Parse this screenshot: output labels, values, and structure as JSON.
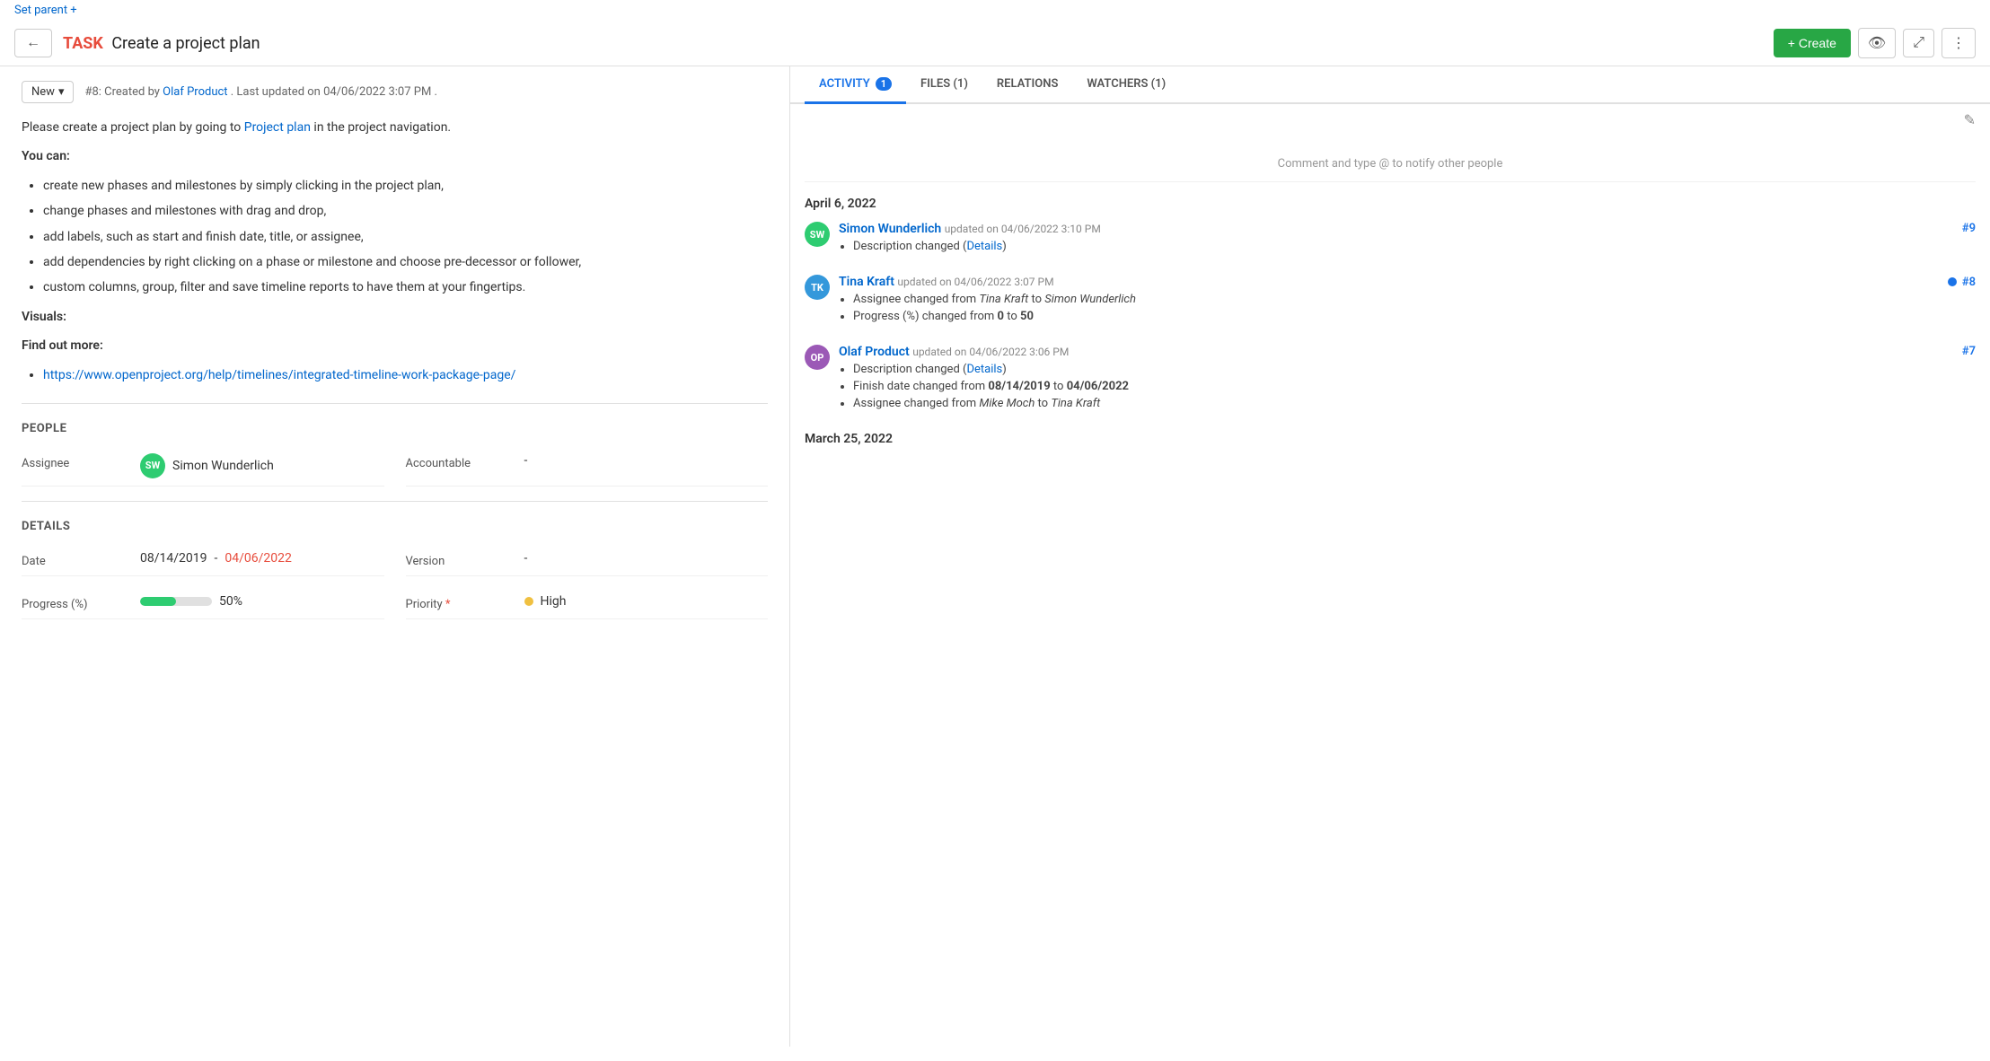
{
  "header": {
    "back_label": "←",
    "task_label": "TASK",
    "title": "Create a project plan",
    "create_label": "+ Create",
    "create_arrow": "▾",
    "watch_icon": "👁",
    "expand_icon": "⤢",
    "more_icon": "⋮"
  },
  "set_parent": {
    "label": "Set parent +",
    "href": "#"
  },
  "status": {
    "badge_label": "New",
    "badge_arrow": "▾",
    "meta": "#8: Created by ",
    "author": "Olaf Product",
    "meta_after": " . Last updated on 04/06/2022 3:07 PM ."
  },
  "description": {
    "intro": "Please create a project plan by going to ",
    "link_text": "Project plan",
    "intro_after": " in the project navigation.",
    "you_can": "You can:",
    "bullets": [
      "create new phases and milestones by simply clicking in the project plan,",
      "change phases and milestones with drag and drop,",
      "add labels, such as start and finish date, title, or assignee,",
      "add dependencies by right clicking on a phase or milestone and choose pre-decessor or follower,",
      "custom columns, group, filter and save timeline reports to have them at your fingertips."
    ],
    "visuals": "Visuals:",
    "find_out": "Find out more:",
    "link_url": "https://www.openproject.org/help/timelines/integrated-timeline-work-package-page/"
  },
  "people_section": {
    "title": "PEOPLE",
    "assignee_label": "Assignee",
    "assignee_name": "Simon Wunderlich",
    "assignee_initials": "SW",
    "accountable_label": "Accountable",
    "accountable_value": "-"
  },
  "details_section": {
    "title": "DETAILS",
    "date_label": "Date",
    "date_start": "08/14/2019",
    "date_dash": " - ",
    "date_end": "04/06/2022",
    "version_label": "Version",
    "version_value": "-",
    "progress_label": "Progress (%)",
    "progress_value": 50,
    "progress_display": "50%",
    "priority_label": "Priority",
    "priority_value": "High",
    "priority_required": "*"
  },
  "tabs": [
    {
      "id": "activity",
      "label": "ACTIVITY",
      "badge": "1",
      "active": true
    },
    {
      "id": "files",
      "label": "FILES (1)",
      "badge": null,
      "active": false
    },
    {
      "id": "relations",
      "label": "RELATIONS",
      "badge": null,
      "active": false
    },
    {
      "id": "watchers",
      "label": "WATCHERS (1)",
      "badge": null,
      "active": false
    }
  ],
  "activity": {
    "comment_hint": "Comment and type @ to notify other people",
    "date_group_1": "April 6, 2022",
    "items": [
      {
        "id": "9",
        "user": "Simon Wunderlich",
        "initials": "SW",
        "avatar_class": "avatar-sw",
        "meta": "updated on 04/06/2022 3:10 PM",
        "changes": [
          {
            "text": "Description changed (",
            "link": "Details",
            "text_after": ")"
          }
        ],
        "has_dot": false
      },
      {
        "id": "8",
        "user": "Tina Kraft",
        "initials": "TK",
        "avatar_class": "avatar-tk",
        "meta": "updated on 04/06/2022 3:07 PM",
        "changes": [
          {
            "text": "Assignee changed from Tina Kraft to Simon Wunderlich"
          },
          {
            "text": "Progress (%) changed from 0 to 50"
          }
        ],
        "has_dot": true
      },
      {
        "id": "7",
        "user": "Olaf Product",
        "initials": "OP",
        "avatar_class": "avatar-op",
        "meta": "updated on 04/06/2022 3:06 PM",
        "changes": [
          {
            "text": "Description changed (",
            "link": "Details",
            "text_after": ")"
          },
          {
            "text": "Finish date changed from 08/14/2019 to 04/06/2022"
          },
          {
            "text": "Assignee changed from Mike Moch to Tina Kraft"
          }
        ],
        "has_dot": false
      }
    ],
    "date_group_2": "March 25, 2022"
  }
}
